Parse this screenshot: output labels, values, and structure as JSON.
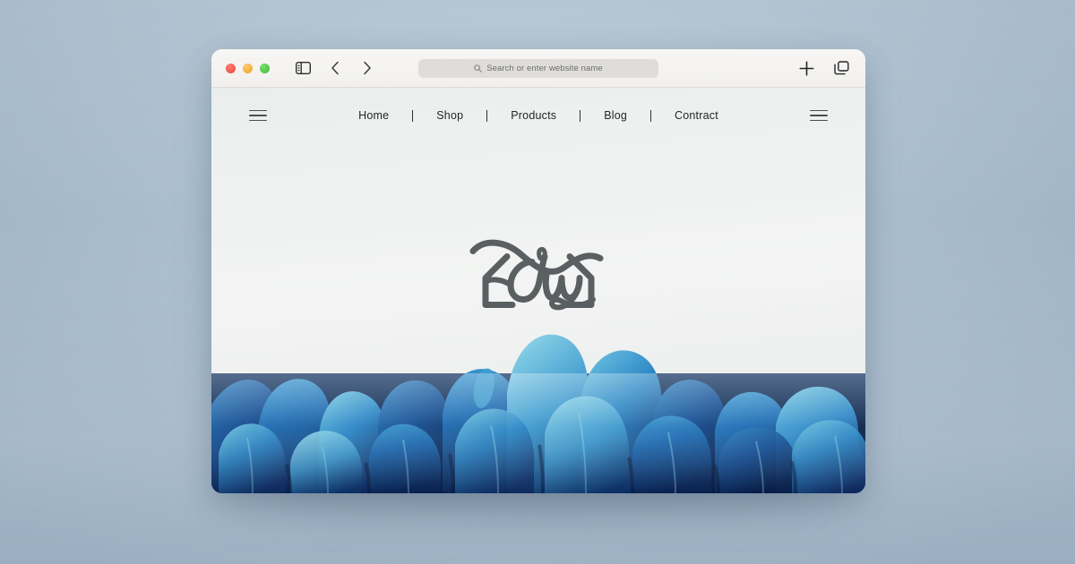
{
  "scene": {
    "background_color": "#aabdcd",
    "description": "Browser window mockup on soft blue-gray backdrop"
  },
  "browser": {
    "traffic_lights": [
      {
        "name": "close",
        "color": "#e8463a"
      },
      {
        "name": "minimize",
        "color": "#f0a02a"
      },
      {
        "name": "maximize",
        "color": "#3dbd36"
      }
    ],
    "toolbar_icons_left": [
      {
        "name": "sidebar-toggle-icon",
        "label": "Show Sidebar"
      },
      {
        "name": "back-icon",
        "label": "Back"
      },
      {
        "name": "forward-icon",
        "label": "Forward"
      }
    ],
    "address_bar": {
      "placeholder": "Search or enter website name",
      "value": "",
      "icon": "search-icon"
    },
    "toolbar_icons_right": [
      {
        "name": "new-tab-icon",
        "label": "New Tab"
      },
      {
        "name": "tab-overview-icon",
        "label": "Show Tab Overview"
      }
    ]
  },
  "site": {
    "nav": {
      "left_menu_icon": "hamburger-menu-icon",
      "right_menu_icon": "hamburger-menu-icon",
      "links": [
        {
          "label": "Home"
        },
        {
          "label": "Shop"
        },
        {
          "label": "Products"
        },
        {
          "label": "Blog"
        },
        {
          "label": "Contract"
        }
      ],
      "separator": "|",
      "text_color": "#1f2426"
    },
    "hero": {
      "logo": {
        "name": "dw-monogram-logo",
        "text": "dw",
        "color": "#5a5f61",
        "style": "script monogram with diamond outline and swash flourishes"
      },
      "background_color": "#f1f3f2",
      "image": {
        "name": "blue-flower-petals-photo",
        "subject": "close-up of blue flower petals",
        "colors": [
          "#0b2f66",
          "#1464ad",
          "#2a8ecb",
          "#5fc2de",
          "#0a1f46"
        ]
      }
    }
  }
}
